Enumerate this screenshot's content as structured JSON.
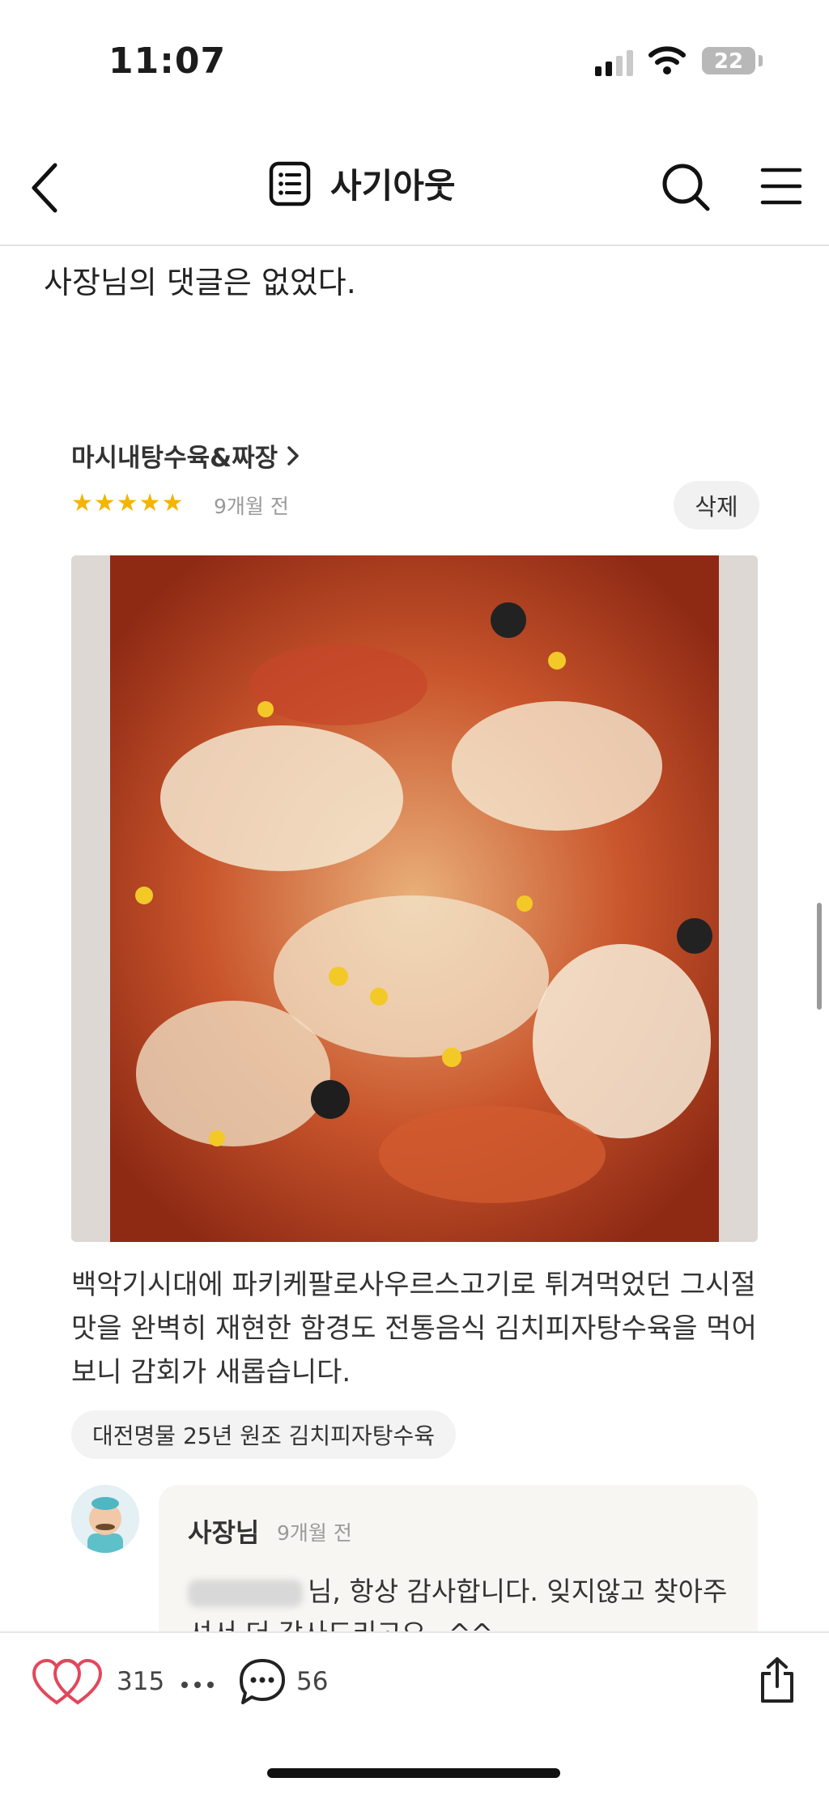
{
  "status_bar": {
    "time": "11:07",
    "battery": "22"
  },
  "nav": {
    "title": "사기아웃"
  },
  "post": {
    "intro_text": "사장님의 댓글은 없었다."
  },
  "review": {
    "shop_name": "마시내탕수육&짜장",
    "rating": 5,
    "stars": "★★★★★",
    "date": "9개월 전",
    "delete_label": "삭제",
    "text": "백악기시대에 파키케팔로사우르스고기로 튀겨먹었던 그시절 맛을 완벽히 재현한 함경도 전통음식 김치피자탕수육을 먹어보니 감회가 새롭습니다.",
    "tags": "대전명물  25년 원조  김치피자탕수육"
  },
  "owner_reply": {
    "author": "사장님",
    "date": "9개월 전",
    "text": "님, 항상 감사합니다. 잊지않고 찾아주셔서 더 감사드리고요~^^"
  },
  "bottom_bar": {
    "likes": "315",
    "comments": "56"
  }
}
